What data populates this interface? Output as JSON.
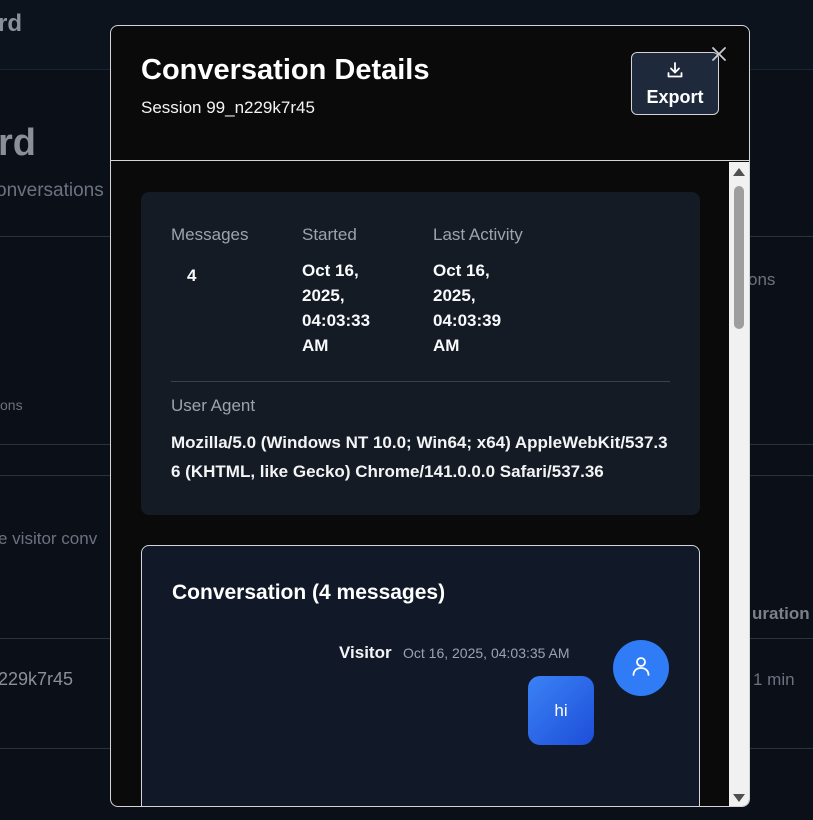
{
  "background": {
    "brand": "rd",
    "title": "rd",
    "subtitle": "onversations",
    "col_text": "ons",
    "small_text": "ons",
    "desc": "e visitor conv",
    "duration_header": "uration",
    "row_session": "229k7r45",
    "row_duration": "1 min"
  },
  "modal": {
    "title": "Conversation Details",
    "subtitle": "Session 99_n229k7r45",
    "export_label": "Export",
    "info": {
      "messages_label": "Messages",
      "messages_value": "4",
      "started_label": "Started",
      "started_value_lines": [
        "Oct 16,",
        "2025,",
        "04:03:33",
        "AM"
      ],
      "last_activity_label": "Last Activity",
      "last_activity_value_lines": [
        "Oct 16,",
        "2025,",
        "04:03:39",
        "AM"
      ],
      "user_agent_label": "User Agent",
      "user_agent_value": "Mozilla/5.0 (Windows NT 10.0; Win64; x64) AppleWebKit/537.36 (KHTML, like Gecko) Chrome/141.0.0.0 Safari/537.36"
    },
    "conversation": {
      "title": "Conversation (4 messages)",
      "messages": [
        {
          "sender": "Visitor",
          "time": "Oct 16, 2025, 04:03:35 AM",
          "text": "hi"
        }
      ]
    }
  },
  "colors": {
    "accent": "#2f7cf6",
    "modal_bg": "#0a0a0a",
    "card_bg": "#141b24"
  },
  "icons": {
    "export": "download-icon",
    "close": "close-icon",
    "avatar": "user-icon"
  }
}
